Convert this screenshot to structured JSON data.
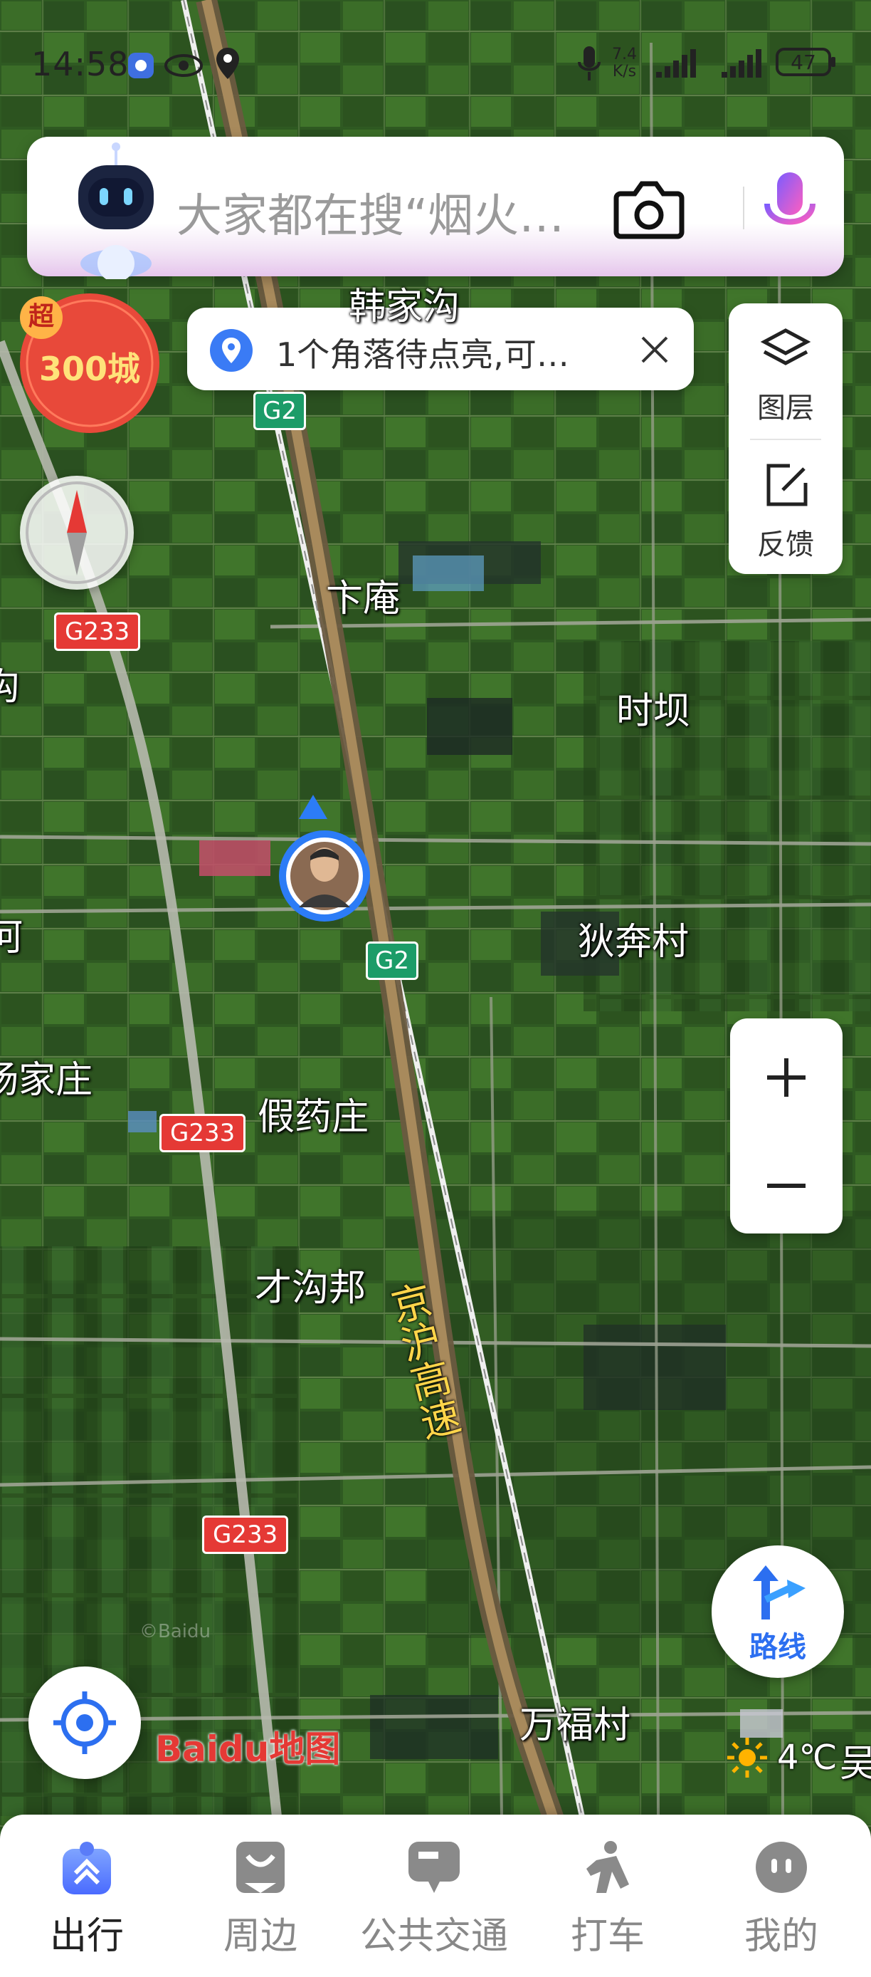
{
  "status_bar": {
    "time": "14:58",
    "net_speed_top": "7.4",
    "net_speed_unit": "K/s",
    "battery": "47",
    "icons": [
      "notification-icon",
      "eye-icon",
      "location-icon",
      "mic-icon",
      "signal-icon",
      "signal-icon",
      "battery-icon"
    ]
  },
  "search": {
    "placeholder": "大家都在搜“烟火…",
    "icons": [
      "robot-avatar-icon",
      "camera-icon",
      "mic-icon"
    ]
  },
  "promo_badge": {
    "tag": "超",
    "text": "300城"
  },
  "notice": {
    "text": "1个角落待点亮,可…",
    "icons": [
      "pin-icon",
      "close-icon"
    ]
  },
  "tools": {
    "layers_label": "图层",
    "feedback_label": "反馈"
  },
  "map": {
    "places": [
      "韩家沟",
      "卞庵",
      "时坝",
      "狄奔村",
      "杨家庄",
      "假药庄",
      "才沟邦",
      "万福村",
      "沟",
      "河",
      "吴"
    ],
    "roads": {
      "g2": "G2",
      "g233": "G233",
      "highway_name": "京沪高速"
    },
    "watermark": "©Baidu",
    "logo_text": "Baidu地图",
    "weather": {
      "temp": "4℃",
      "icon": "sun-icon"
    }
  },
  "route_button": {
    "label": "路线"
  },
  "bottom_nav": {
    "items": [
      {
        "label": "出行",
        "icon": "travel-icon",
        "active": true
      },
      {
        "label": "周边",
        "icon": "nearby-icon",
        "active": false
      },
      {
        "label": "公共交通",
        "icon": "bus-icon",
        "active": false
      },
      {
        "label": "打车",
        "icon": "taxi-icon",
        "active": false
      },
      {
        "label": "我的",
        "icon": "profile-icon",
        "active": false
      }
    ]
  },
  "colors": {
    "accent": "#3a7bf5",
    "route_red": "#e53935",
    "nav_active": "#222222"
  }
}
